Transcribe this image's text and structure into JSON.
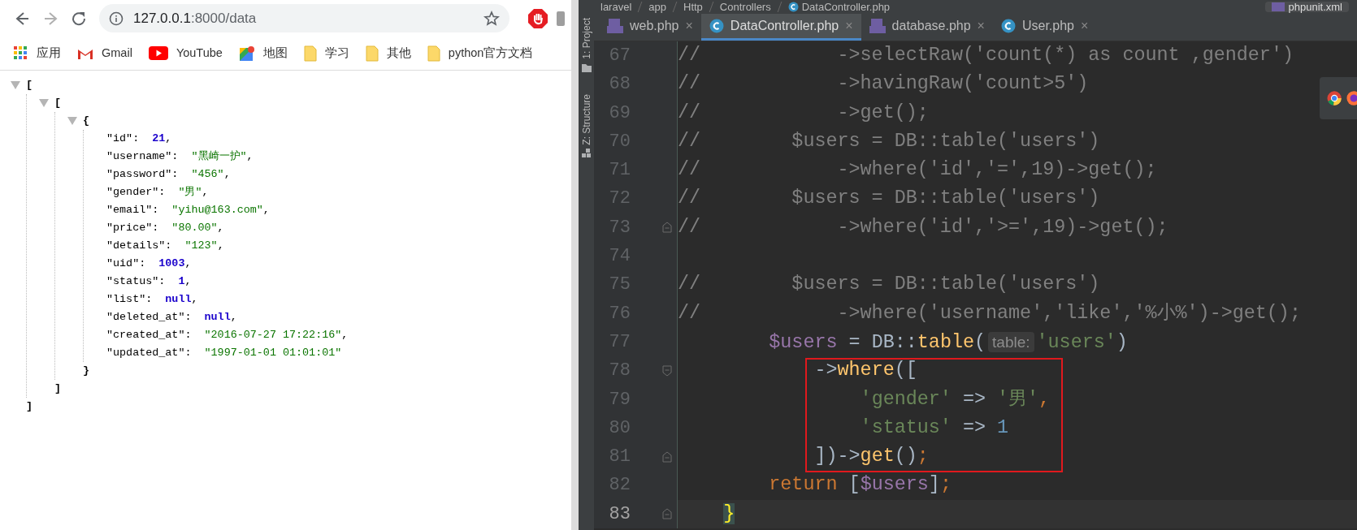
{
  "browser": {
    "nav_buttons": [
      {
        "kind": "back",
        "disabled": false
      },
      {
        "kind": "forward",
        "disabled": true
      },
      {
        "kind": "reload",
        "disabled": false
      }
    ],
    "address": {
      "host": "127.0.0.1",
      "path": ":8000/data"
    },
    "bookmarks": [
      {
        "kind": "apps",
        "label": "应用"
      },
      {
        "kind": "mail",
        "label": "Gmail"
      },
      {
        "kind": "video",
        "label": "YouTube"
      },
      {
        "kind": "map",
        "label": "地图"
      },
      {
        "kind": "folder",
        "label": "学习"
      },
      {
        "kind": "folder",
        "label": "其他"
      },
      {
        "kind": "folder",
        "label": "python官方文档"
      }
    ],
    "json_view": {
      "open": "[",
      "close": "]",
      "expanded": true,
      "children": [
        {
          "open": "[",
          "close": "]",
          "expanded": true,
          "children": [
            {
              "open": "{",
              "close": "}",
              "expanded": true,
              "entries": [
                {
                  "key": "\"id\":",
                  "value": "21",
                  "kind": "number",
                  "suffix": ","
                },
                {
                  "key": "\"username\":",
                  "value": "\"黑崎一护\"",
                  "kind": "string",
                  "suffix": ","
                },
                {
                  "key": "\"password\":",
                  "value": "\"456\"",
                  "kind": "string",
                  "suffix": ","
                },
                {
                  "key": "\"gender\":",
                  "value": "\"男\"",
                  "kind": "string",
                  "suffix": ","
                },
                {
                  "key": "\"email\":",
                  "value": "\"yihu@163.com\"",
                  "kind": "string",
                  "suffix": ","
                },
                {
                  "key": "\"price\":",
                  "value": "\"80.00\"",
                  "kind": "string",
                  "suffix": ","
                },
                {
                  "key": "\"details\":",
                  "value": "\"123\"",
                  "kind": "string",
                  "suffix": ","
                },
                {
                  "key": "\"uid\":",
                  "value": "1003",
                  "kind": "number",
                  "suffix": ","
                },
                {
                  "key": "\"status\":",
                  "value": "1",
                  "kind": "number",
                  "suffix": ","
                },
                {
                  "key": "\"list\":",
                  "value": "null",
                  "kind": "number",
                  "suffix": ","
                },
                {
                  "key": "\"deleted_at\":",
                  "value": "null",
                  "kind": "number",
                  "suffix": ","
                },
                {
                  "key": "\"created_at\":",
                  "value": "\"2016-07-27 17:22:16\"",
                  "kind": "string",
                  "suffix": ","
                },
                {
                  "key": "\"updated_at\":",
                  "value": "\"1997-01-01 01:01:01\"",
                  "kind": "string"
                }
              ]
            }
          ]
        }
      ]
    }
  },
  "ide": {
    "breadcrumb": [
      {
        "label": "laravel",
        "kind": "dir"
      },
      {
        "label": "app",
        "kind": "dir"
      },
      {
        "label": "Http",
        "kind": "dir"
      },
      {
        "label": "Controllers",
        "kind": "dir"
      },
      {
        "label": "DataController.php",
        "kind": "class"
      }
    ],
    "corner_tab": "phpunit.xml",
    "tool_windows": [
      {
        "label": "1: Project",
        "kind": "folder"
      },
      {
        "label": "Z: Structure",
        "kind": "structure"
      }
    ],
    "tabs": [
      {
        "label": "web.php",
        "kind": "php",
        "selected": false,
        "close": "×"
      },
      {
        "label": "DataController.php",
        "kind": "class",
        "selected": true,
        "close": "×"
      },
      {
        "label": "database.php",
        "kind": "php",
        "selected": false,
        "close": "×"
      },
      {
        "label": "User.php",
        "kind": "class",
        "selected": false,
        "close": "×"
      }
    ],
    "lines": [
      {
        "number": "67",
        "current": false,
        "boxed": false,
        "tokens": [
          {
            "kind": "comment",
            "text": "//            ->selectRaw('count(*) as count ,gender')"
          }
        ]
      },
      {
        "number": "68",
        "current": false,
        "boxed": false,
        "tokens": [
          {
            "kind": "comment",
            "text": "//            ->havingRaw('count>5')"
          }
        ]
      },
      {
        "number": "69",
        "current": false,
        "boxed": false,
        "tokens": [
          {
            "kind": "comment",
            "text": "//            ->get();"
          }
        ]
      },
      {
        "number": "70",
        "current": false,
        "boxed": false,
        "tokens": [
          {
            "kind": "comment",
            "text": "//        $users = DB::table('users')"
          }
        ]
      },
      {
        "number": "71",
        "current": false,
        "boxed": false,
        "tokens": [
          {
            "kind": "comment",
            "text": "//            ->where('id','=',19)->get();"
          }
        ]
      },
      {
        "number": "72",
        "current": false,
        "boxed": false,
        "tokens": [
          {
            "kind": "comment",
            "text": "//        $users = DB::table('users')"
          }
        ]
      },
      {
        "number": "73",
        "current": false,
        "boxed": false,
        "kind": "fold_end",
        "tokens": [
          {
            "kind": "comment",
            "text": "//            ->where('id','>=',19)->get();"
          }
        ]
      },
      {
        "number": "74",
        "current": false,
        "boxed": false
      },
      {
        "number": "75",
        "current": false,
        "boxed": false,
        "tokens": [
          {
            "kind": "comment",
            "text": "//        $users = DB::table('users')"
          }
        ]
      },
      {
        "number": "76",
        "current": false,
        "boxed": false,
        "tokens": [
          {
            "kind": "comment",
            "text": "//            ->where('username','like','%小%')->get();"
          }
        ]
      },
      {
        "number": "77",
        "current": false,
        "boxed": false,
        "tokens": [
          {
            "kind": "var",
            "text": "        $users"
          },
          {
            "kind": "plain",
            "text": " = DB::"
          },
          {
            "kind": "func",
            "text": "table"
          },
          {
            "kind": "plain",
            "text": "("
          },
          {
            "kind": "hint",
            "text": "table:"
          },
          {
            "kind": "string",
            "text": "'users'"
          },
          {
            "kind": "plain",
            "text": ")"
          }
        ]
      },
      {
        "number": "78",
        "current": false,
        "boxed": true,
        "kind": "fold_start",
        "tokens": [
          {
            "kind": "plain",
            "text": "            ->"
          },
          {
            "kind": "func",
            "text": "where"
          },
          {
            "kind": "plain",
            "text": "(["
          }
        ]
      },
      {
        "number": "79",
        "current": false,
        "boxed": true,
        "tokens": [
          {
            "kind": "string",
            "text": "                'gender'"
          },
          {
            "kind": "plain",
            "text": " => "
          },
          {
            "kind": "string",
            "text": "'男'"
          },
          {
            "kind": "keyword",
            "text": ","
          }
        ]
      },
      {
        "number": "80",
        "current": false,
        "boxed": true,
        "tokens": [
          {
            "kind": "string",
            "text": "                'status'"
          },
          {
            "kind": "plain",
            "text": " => "
          },
          {
            "kind": "number",
            "text": "1"
          }
        ]
      },
      {
        "number": "81",
        "current": false,
        "boxed": true,
        "kind": "fold_end",
        "tokens": [
          {
            "kind": "plain",
            "text": "            ])->"
          },
          {
            "kind": "func",
            "text": "get"
          },
          {
            "kind": "plain",
            "text": "()"
          },
          {
            "kind": "keyword",
            "text": ";"
          }
        ]
      },
      {
        "number": "82",
        "current": false,
        "boxed": false,
        "tokens": [
          {
            "kind": "keyword",
            "text": "        return"
          },
          {
            "kind": "plain",
            "text": " ["
          },
          {
            "kind": "var",
            "text": "$users"
          },
          {
            "kind": "plain",
            "text": "]"
          },
          {
            "kind": "keyword",
            "text": ";"
          }
        ]
      },
      {
        "number": "83",
        "current": true,
        "boxed": false,
        "kind": "fold_end",
        "tokens": [
          {
            "kind": "brace",
            "text": "    }"
          }
        ]
      }
    ]
  }
}
